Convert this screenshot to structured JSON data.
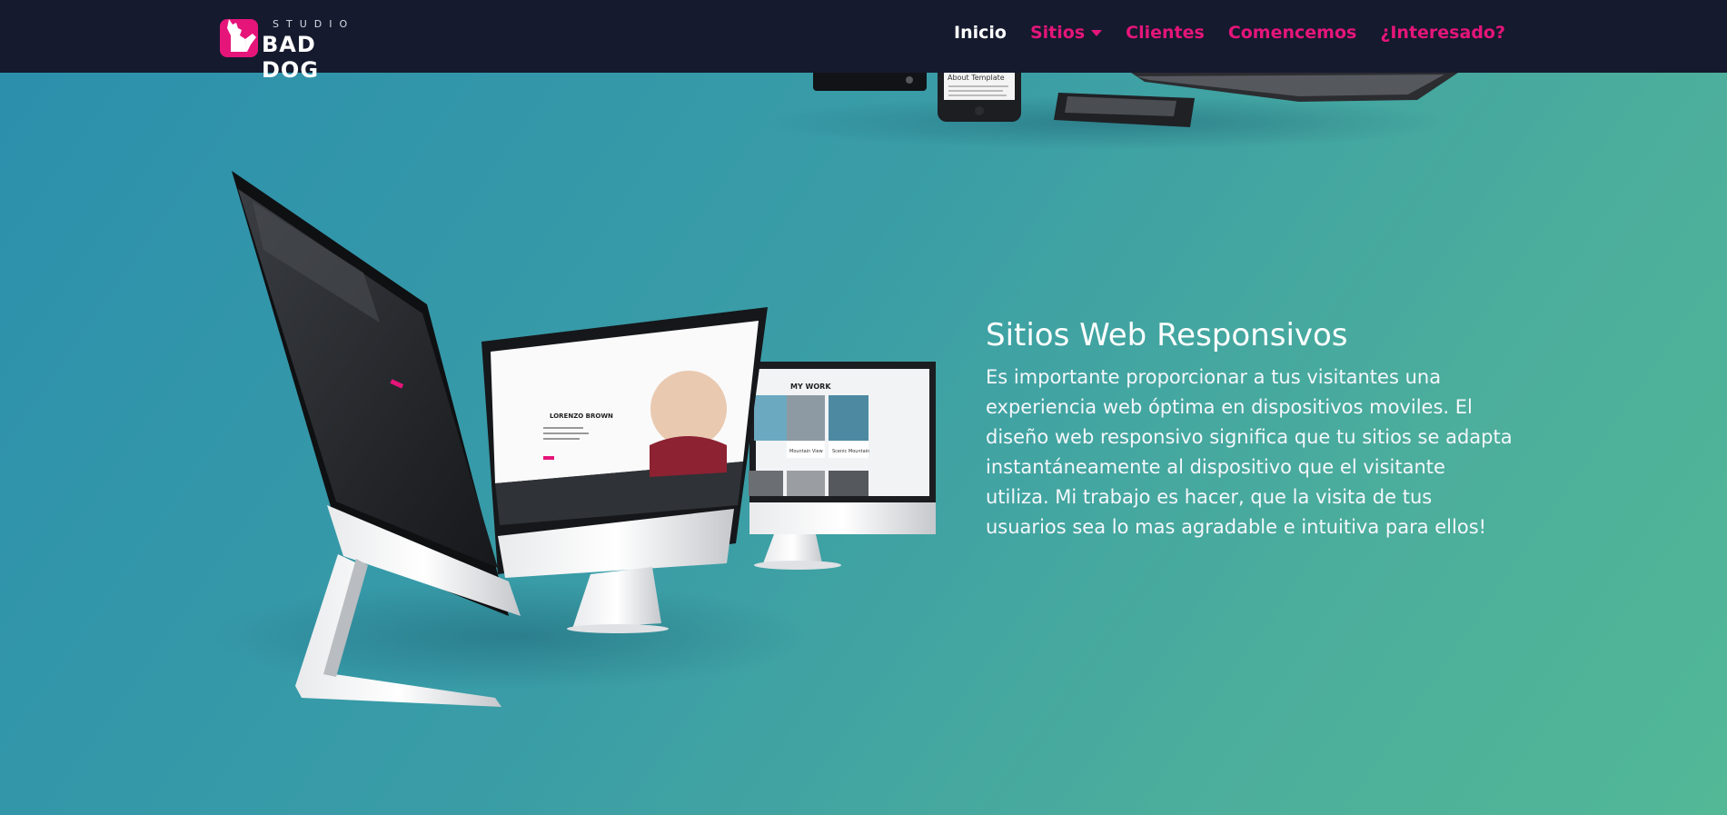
{
  "brand": {
    "studio": "STUDIO",
    "name": "BAD DOG",
    "accent_color": "#e5157a",
    "nav_background": "#151a2e"
  },
  "nav": {
    "items": [
      {
        "label": "Inicio",
        "active": true
      },
      {
        "label": "Sitios",
        "dropdown": true
      },
      {
        "label": "Clientes"
      },
      {
        "label": "Comencemos"
      },
      {
        "label": "¿Interesado?"
      }
    ]
  },
  "section": {
    "title": "Sitios Web Responsivos",
    "body": "Es importante proporcionar a tus visitantes una experiencia web óptima en dispositivos moviles. El diseño web responsivo significa que tu sitios se adapta instantáneamente al dispositivo que el visitante utiliza. Mi trabajo es hacer, que la visita de tus usuarios sea lo mas agradable e intuitiva para ellos!"
  },
  "mockups": {
    "mid_screen_name": "LORENZO BROWN",
    "right_screen_heading": "MY WORK",
    "right_screen_card1": "Mountain View",
    "right_screen_card2": "Scenic Mountain",
    "phone_heading": "About Template"
  }
}
